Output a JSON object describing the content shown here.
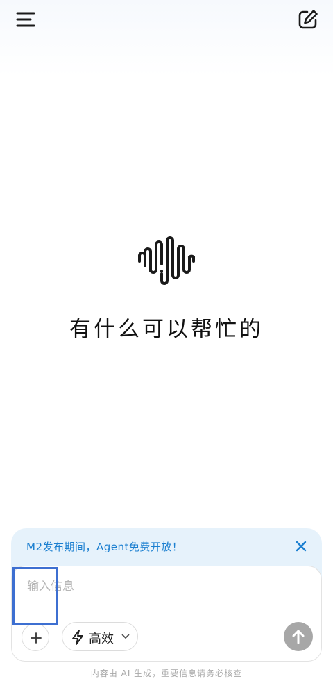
{
  "header": {
    "menu_icon": "hamburger-menu-icon",
    "new_chat_icon": "edit-square-icon"
  },
  "hero": {
    "logo_icon": "sound-wave-icon",
    "greeting": "有什么可以帮忙的"
  },
  "banner": {
    "text": "M2发布期间，Agent免费开放！",
    "close_icon": "close-icon",
    "text_color": "#1b7fd0",
    "background": "#e6f2fb"
  },
  "composer": {
    "input_placeholder": "输入信息",
    "input_value": "",
    "attach_icon": "plus-icon",
    "mode_label": "高效",
    "mode_icon": "lightning-icon",
    "mode_dropdown_icon": "chevron-down-icon",
    "send_icon": "arrow-up-icon",
    "send_color": "#a7a7a7",
    "highlight_color": "#3d6fd1"
  },
  "footer": {
    "disclaimer": "内容由 AI 生成，重要信息请务必核查"
  }
}
